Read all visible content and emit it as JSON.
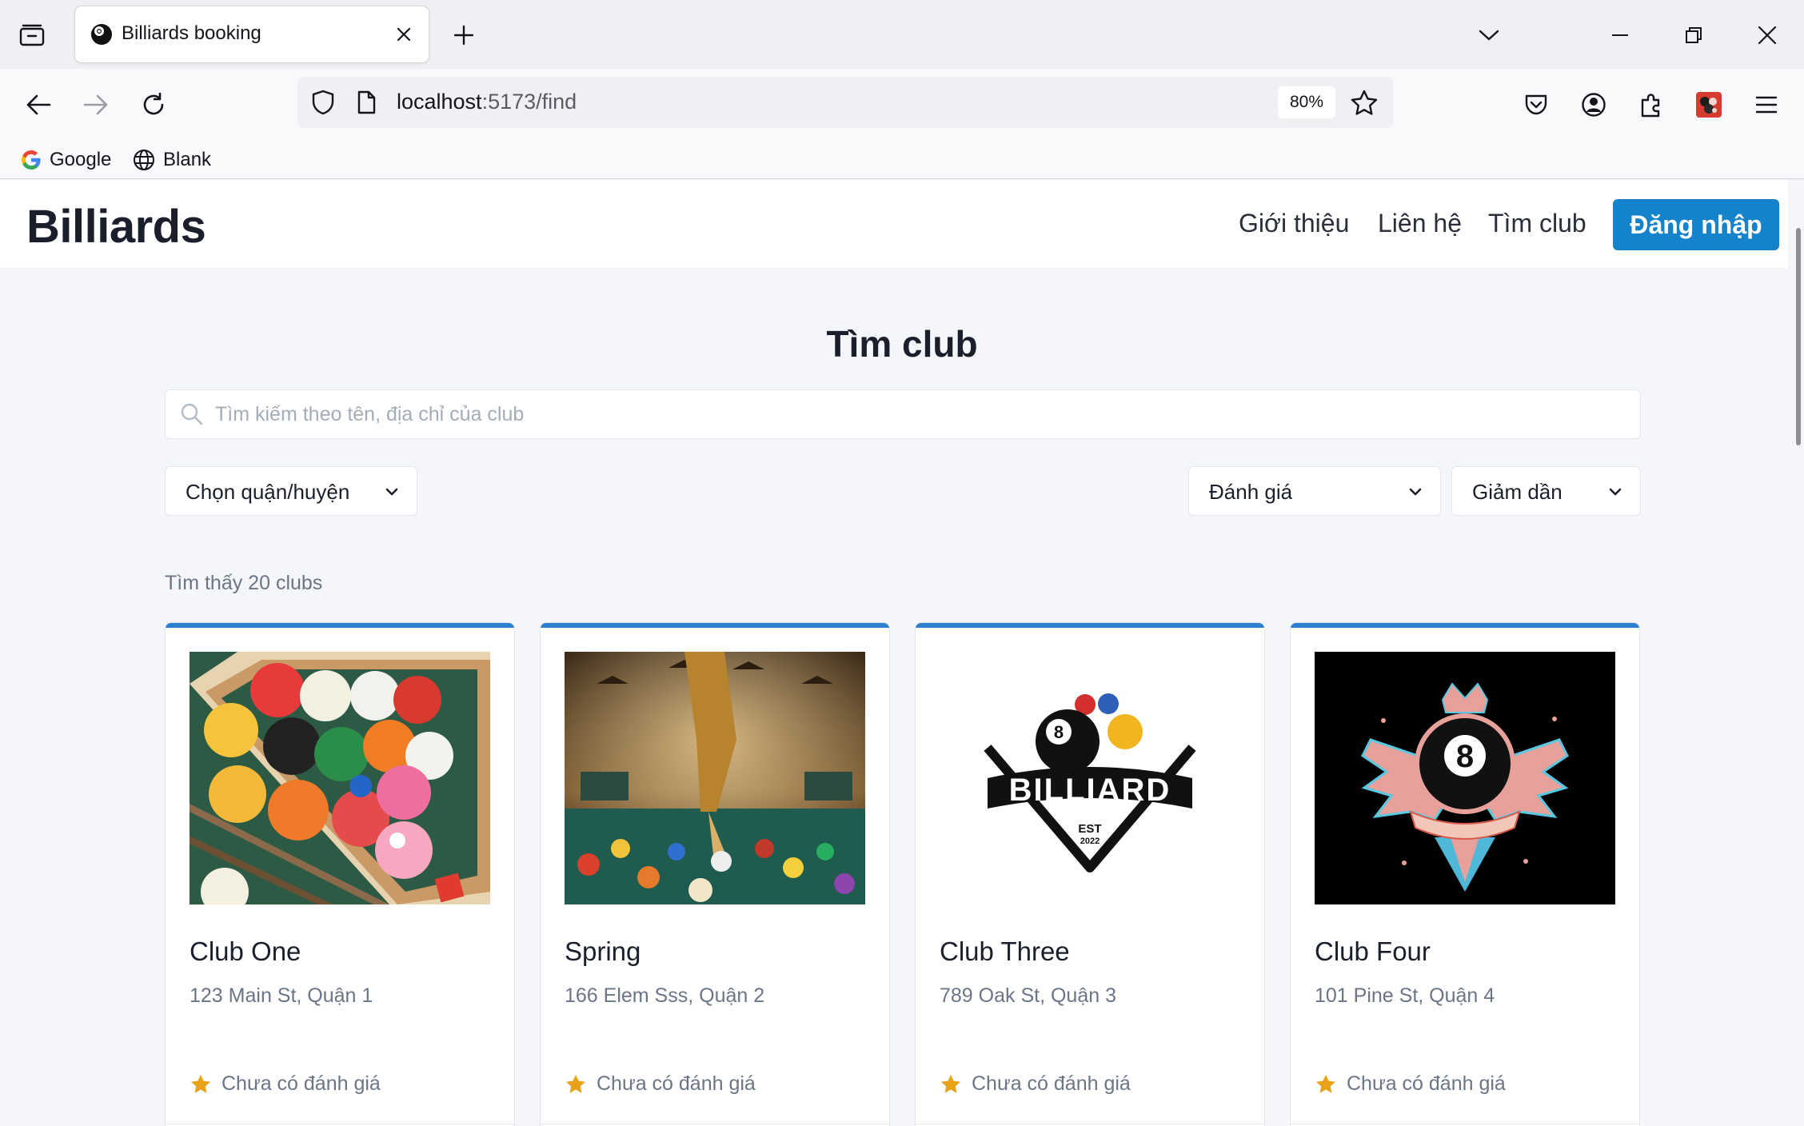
{
  "browser": {
    "tab_title": "Billiards booking",
    "url_host": "localhost",
    "url_path": ":5173/find",
    "zoom": "80%",
    "bookmarks": [
      {
        "label": "Google",
        "icon": "google-icon"
      },
      {
        "label": "Blank",
        "icon": "globe-icon"
      }
    ]
  },
  "header": {
    "brand": "Billiards",
    "nav": [
      "Giới thiệu",
      "Liên hệ",
      "Tìm club"
    ],
    "login_label": "Đăng nhập",
    "accent_color": "#1483cc"
  },
  "main": {
    "title": "Tìm club",
    "search_placeholder": "Tìm kiếm theo tên, địa chỉ của club",
    "district_select": "Chọn quận/huyện",
    "sort_by_select": "Đánh giá",
    "sort_order_select": "Giảm dần",
    "results_count": "Tìm thấy 20 clubs"
  },
  "clubs": [
    {
      "name": "Club One",
      "address": "123 Main St, Quận 1",
      "rating": "Chưa có đánh giá",
      "image": "billiard-balls-rack-illustration"
    },
    {
      "name": "Spring",
      "address": "166 Elem Sss, Quận 2",
      "rating": "Chưa có đánh giá",
      "image": "player-at-pool-table-illustration"
    },
    {
      "name": "Club Three",
      "address": "789 Oak St, Quận 3",
      "rating": "Chưa có đánh giá",
      "image": "billiard-logo"
    },
    {
      "name": "Club Four",
      "address": "101 Pine St, Quận 4",
      "rating": "Chưa có đánh giá",
      "image": "winged-eight-ball-emblem"
    }
  ],
  "billiard_logo": {
    "word": "BILLIARD",
    "est": "EST",
    "year": "2022"
  }
}
